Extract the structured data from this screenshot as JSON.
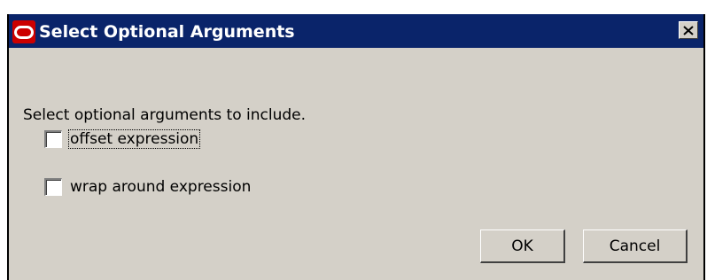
{
  "window": {
    "title": "Select Optional Arguments",
    "icon": "oracle-logo-icon",
    "title_bar_color": "#0a246a",
    "background_color": "#d4d0c8"
  },
  "content": {
    "instruction": "Select optional arguments to include.",
    "options": [
      {
        "label": "offset expression",
        "checked": false,
        "focused": true
      },
      {
        "label": "wrap around expression",
        "checked": false,
        "focused": false
      }
    ]
  },
  "buttons": {
    "ok_label": "OK",
    "cancel_label": "Cancel"
  }
}
